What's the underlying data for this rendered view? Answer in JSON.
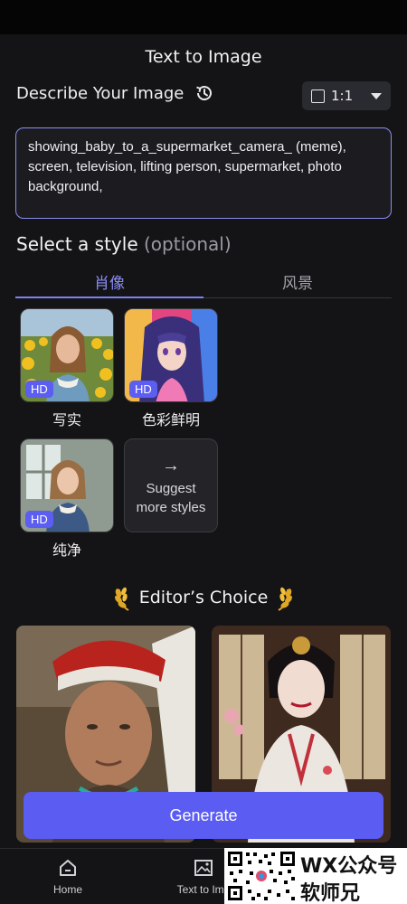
{
  "header": {
    "title": "Text to Image"
  },
  "describe": {
    "label": "Describe Your Image",
    "history_icon": "history-icon",
    "ratio": {
      "value": "1:1",
      "icon": "square-icon"
    },
    "prompt": "showing_baby_to_a_supermarket_camera_ (meme), screen, television, lifting person, supermarket, photo background,"
  },
  "style": {
    "heading": "Select a style",
    "optional": "(optional)",
    "tabs": [
      {
        "label": "肖像",
        "active": true
      },
      {
        "label": "风景",
        "active": false
      }
    ],
    "cards": [
      {
        "name": "写实",
        "badge": "HD"
      },
      {
        "name": "色彩鲜明",
        "badge": "HD"
      },
      {
        "name": "纯净",
        "badge": "HD"
      }
    ],
    "suggest": {
      "arrow": "→",
      "line1": "Suggest",
      "line2": "more styles"
    }
  },
  "editors_choice": {
    "title": "Editor’s Choice"
  },
  "generate": {
    "label": "Generate"
  },
  "nav": [
    {
      "label": "Home",
      "icon": "home-icon"
    },
    {
      "label": "Text to Ima",
      "icon": "image-icon"
    }
  ],
  "watermark": {
    "line1": "WX公众号",
    "line2": "软师兄"
  },
  "colors": {
    "accent": "#5a5cf2",
    "tab_active": "#8a8cf6",
    "background": "#141416"
  }
}
